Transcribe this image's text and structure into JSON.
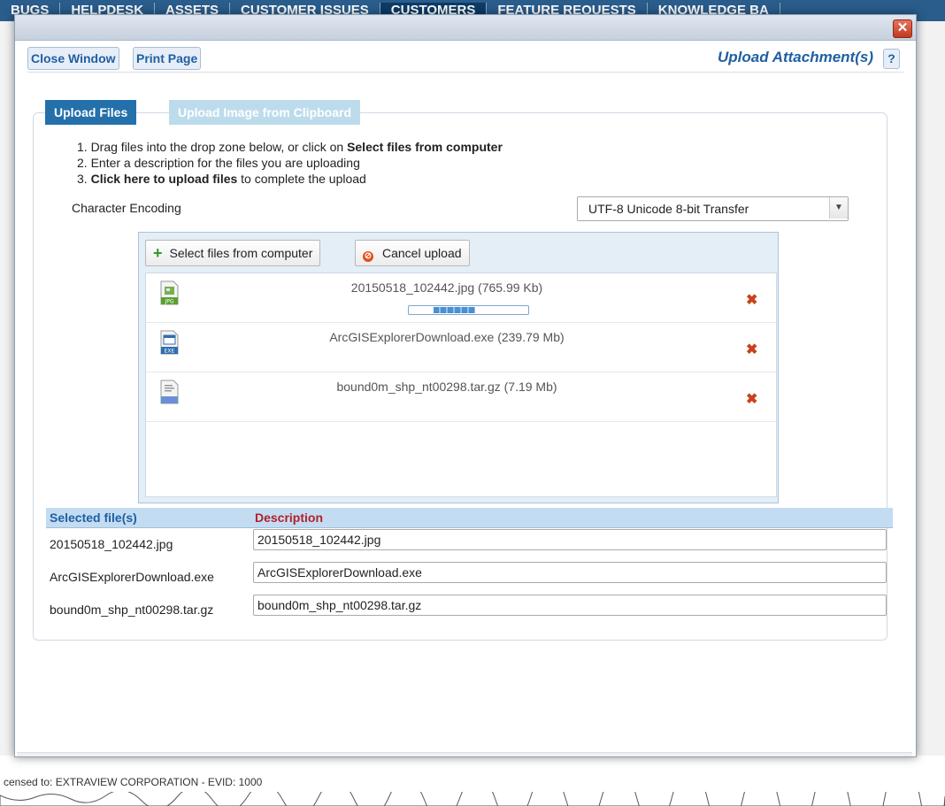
{
  "background": {
    "top_nav": [
      "BUGS",
      "HELPDESK",
      "ASSETS",
      "CUSTOMER ISSUES",
      "CUSTOMERS",
      "FEATURE REQUESTS",
      "KNOWLEDGE BA"
    ],
    "active_nav": "CUSTOMERS",
    "footer_line1": "censed to: EXTRAVIEW CORPORATION - EVID: 1000"
  },
  "modal": {
    "close_label": "✕",
    "toolbar": {
      "close_window": "Close Window",
      "print_page": "Print Page",
      "title": "Upload Attachment(s)",
      "help": "?"
    },
    "tabs": [
      {
        "label": "Upload Files",
        "active": true
      },
      {
        "label": "Upload Image from Clipboard",
        "active": false
      }
    ],
    "instructions": {
      "step1_prefix": "1. Drag files into the drop zone below, or click on ",
      "step1_bold": "Select files from computer",
      "step2": "2. Enter a description for the files you are uploading",
      "step3_prefix": "3. ",
      "step3_bold": "Click here to upload files",
      "step3_suffix": " to complete the upload"
    },
    "encoding": {
      "label": "Character Encoding",
      "selected": "UTF-8 Unicode 8-bit Transfer"
    },
    "uploader": {
      "select_button": "Select files from computer",
      "cancel_button": "Cancel upload",
      "files": [
        {
          "name": "20150518_102442.jpg (765.99 Kb)",
          "icon": "jpg-file-icon",
          "progress": 0.6
        },
        {
          "name": "ArcGISExplorerDownload.exe (239.79 Mb)",
          "icon": "exe-file-icon"
        },
        {
          "name": "bound0m_shp_nt00298.tar.gz (7.19 Mb)",
          "icon": "archive-file-icon"
        }
      ]
    },
    "table": {
      "col_selected": "Selected file(s)",
      "col_description": "Description",
      "rows": [
        {
          "file": "20150518_102442.jpg",
          "description": "20150518_102442.jpg"
        },
        {
          "file": "ArcGISExplorerDownload.exe",
          "description": "ArcGISExplorerDownload.exe"
        },
        {
          "file": "bound0m_shp_nt00298.tar.gz",
          "description": "bound0m_shp_nt00298.tar.gz"
        }
      ]
    }
  },
  "colors": {
    "accent": "#1f5fa3",
    "tab_active": "#2470ab",
    "tab_inactive": "#bcdcec",
    "description_header": "#b2202a",
    "remove": "#c8431b"
  }
}
